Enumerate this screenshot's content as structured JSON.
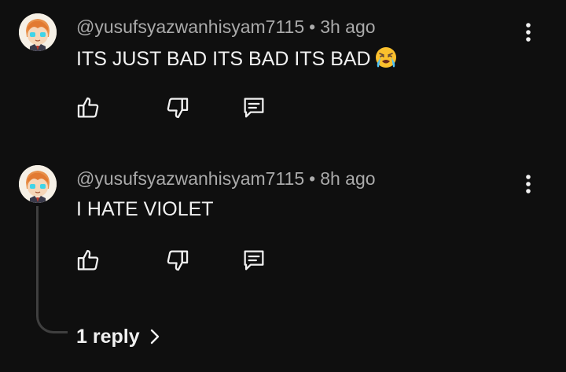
{
  "comments": [
    {
      "author": "@yusufsyazwanhisyam7115",
      "separator": "•",
      "time": "3h ago",
      "text": "ITS JUST BAD ITS BAD ITS BAD",
      "emoji": "loudly-crying-face"
    },
    {
      "author": "@yusufsyazwanhisyam7115",
      "separator": "•",
      "time": "8h ago",
      "text": "I HATE VIOLET"
    }
  ],
  "replies": {
    "label": "1 reply"
  },
  "icons": {
    "like": "thumbs-up-icon",
    "dislike": "thumbs-down-icon",
    "reply": "comment-icon",
    "more": "more-vert-icon"
  },
  "colors": {
    "background": "#0f0f0f",
    "text": "#f1f1f1",
    "secondary_text": "#aaaaaa",
    "thread_line": "#3f3f3f"
  }
}
